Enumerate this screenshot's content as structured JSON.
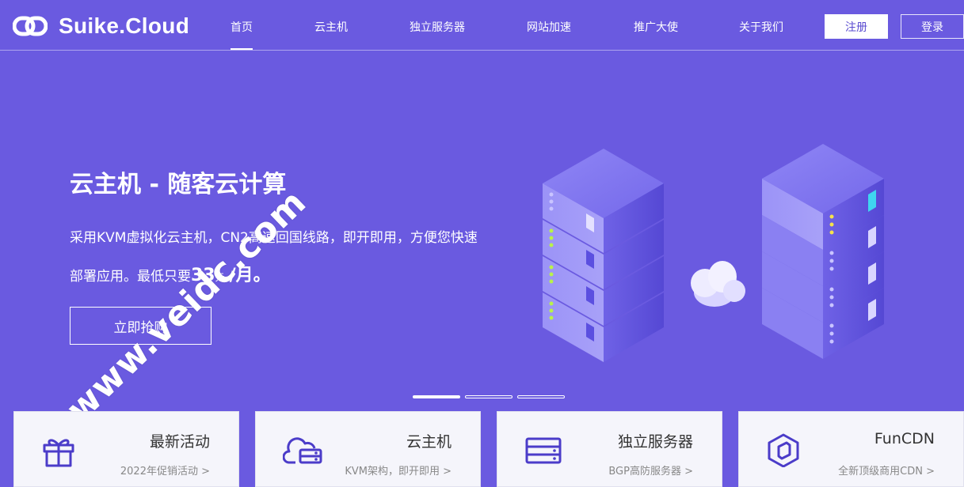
{
  "header": {
    "brand": "Suike.Cloud",
    "nav": [
      {
        "label": "首页",
        "active": true
      },
      {
        "label": "云主机",
        "active": false
      },
      {
        "label": "独立服务器",
        "active": false
      },
      {
        "label": "网站加速",
        "active": false
      },
      {
        "label": "推广大使",
        "active": false
      },
      {
        "label": "关于我们",
        "active": false
      }
    ],
    "register_label": "注册",
    "login_label": "登录"
  },
  "hero": {
    "title": "云主机 - 随客云计算",
    "desc_line1": "采用KVM虚拟化云主机，CN2高速回国线路，即开即用，方便您快速",
    "desc_line2_prefix": "部署应用。最低只要",
    "price": "33",
    "price_unit": "元",
    "price_per": "/月。",
    "cta_label": "立即抢购",
    "slides_total": 3,
    "slide_active": 1
  },
  "watermark": "www.veidc.com",
  "cards": [
    {
      "title": "最新活动",
      "subtitle": "2022年促销活动 >",
      "icon": "gift-icon"
    },
    {
      "title": "云主机",
      "subtitle": "KVM架构，即开即用 >",
      "icon": "cloud-server-icon"
    },
    {
      "title": "独立服务器",
      "subtitle": "BGP高防服务器 >",
      "icon": "server-icon"
    },
    {
      "title": "FunCDN",
      "subtitle": "全新顶级商用CDN >",
      "icon": "cdn-cube-icon"
    }
  ],
  "colors": {
    "brand_purple": "#6a5ae0",
    "icon_purple": "#5a4bd0",
    "white": "#ffffff"
  }
}
